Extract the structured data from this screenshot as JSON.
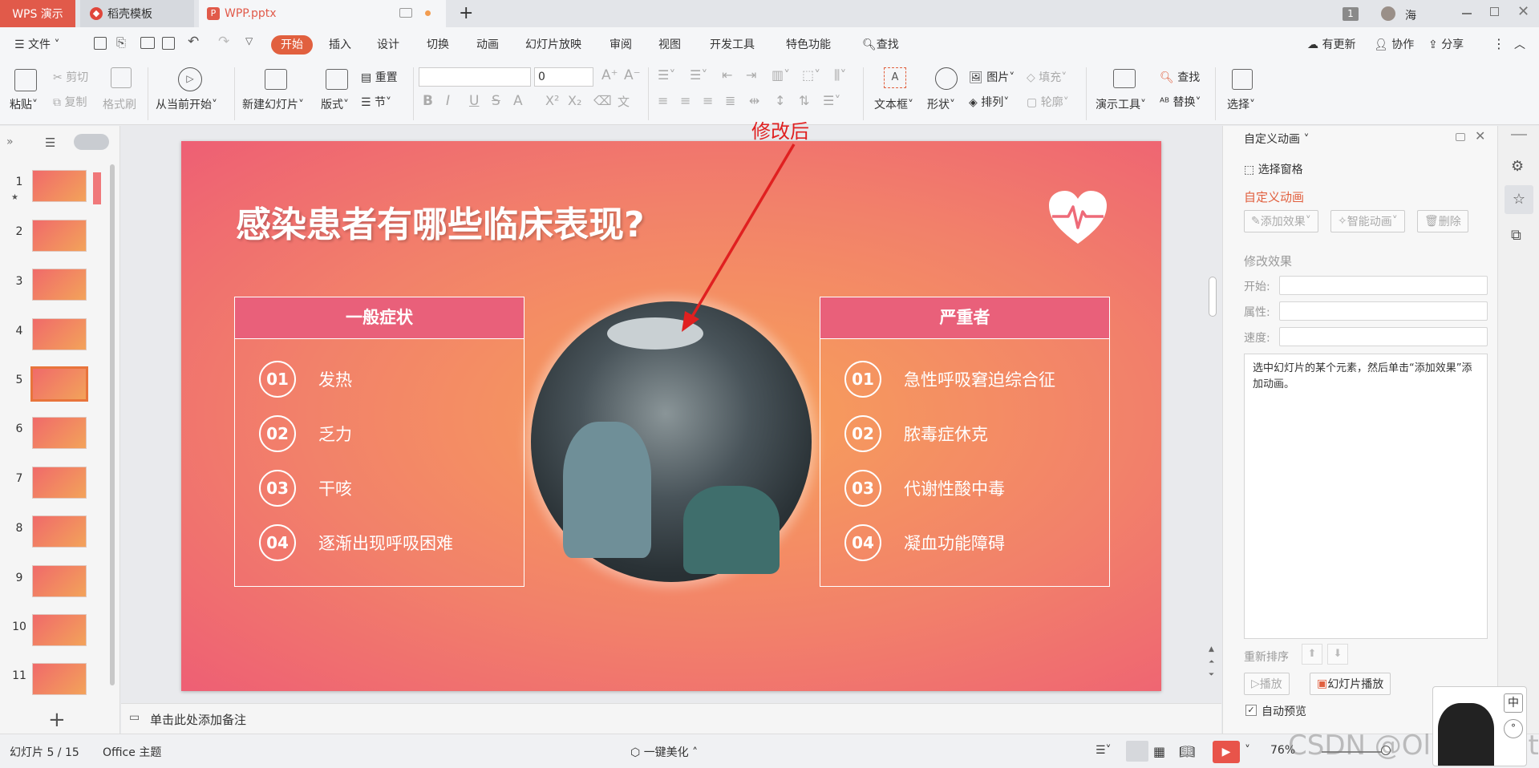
{
  "titlebar": {
    "tabs": [
      {
        "label": "WPS 演示"
      },
      {
        "label": "稻壳模板"
      },
      {
        "label": "WPP.pptx"
      }
    ],
    "badge": "1",
    "user": "海"
  },
  "menu": {
    "file": "文件",
    "items": [
      "开始",
      "插入",
      "设计",
      "切换",
      "动画",
      "幻灯片放映",
      "审阅",
      "视图",
      "开发工具",
      "特色功能",
      "查找"
    ],
    "right": [
      "有更新",
      "协作",
      "分享"
    ]
  },
  "ribbon": {
    "paste": "粘贴",
    "cut": "剪切",
    "copy": "复制",
    "format_painter": "格式刷",
    "from_current": "从当前开始",
    "new_slide": "新建幻灯片",
    "layout": "版式",
    "reset": "重置",
    "section": "节",
    "font_size": "0",
    "textbox": "文本框",
    "shape": "形状",
    "picture": "图片",
    "arrange": "排列",
    "fill": "填充",
    "outline": "轮廓",
    "presenter_tools": "演示工具",
    "find": "查找",
    "replace": "替换",
    "select": "选择"
  },
  "thumbnails": [
    "1",
    "2",
    "3",
    "4",
    "5",
    "6",
    "7",
    "8",
    "9",
    "10",
    "11"
  ],
  "annotation": "修改后",
  "slide": {
    "title": "感染患者有哪些临床表现?",
    "left_box": {
      "header": "一般症状",
      "items": [
        {
          "num": "01",
          "text": "发热"
        },
        {
          "num": "02",
          "text": "乏力"
        },
        {
          "num": "03",
          "text": "干咳"
        },
        {
          "num": "04",
          "text": "逐渐出现呼吸困难"
        }
      ]
    },
    "right_box": {
      "header": "严重者",
      "items": [
        {
          "num": "01",
          "text": "急性呼吸窘迫综合征"
        },
        {
          "num": "02",
          "text": "脓毒症休克"
        },
        {
          "num": "03",
          "text": "代谢性酸中毒"
        },
        {
          "num": "04",
          "text": "凝血功能障碍"
        }
      ]
    }
  },
  "panel": {
    "title": "自定义动画",
    "selection_pane": "选择窗格",
    "section_title": "自定义动画",
    "add_effect": "添加效果",
    "smart_anim": "智能动画",
    "delete": "删除",
    "modify_effect": "修改效果",
    "start": "开始:",
    "property": "属性:",
    "speed": "速度:",
    "hint": "选中幻灯片的某个元素，然后单击“添加效果”添加动画。",
    "reorder": "重新排序",
    "play": "播放",
    "slideshow": "幻灯片播放",
    "auto_preview": "自动预览"
  },
  "notes": "单击此处添加备注",
  "status": {
    "slide_info": "幻灯片 5 / 15",
    "theme": "Office 主题",
    "beautify": "一键美化",
    "zoom": "76%",
    "ime": "中",
    "watermark": "CSDN @Ol Correct"
  }
}
